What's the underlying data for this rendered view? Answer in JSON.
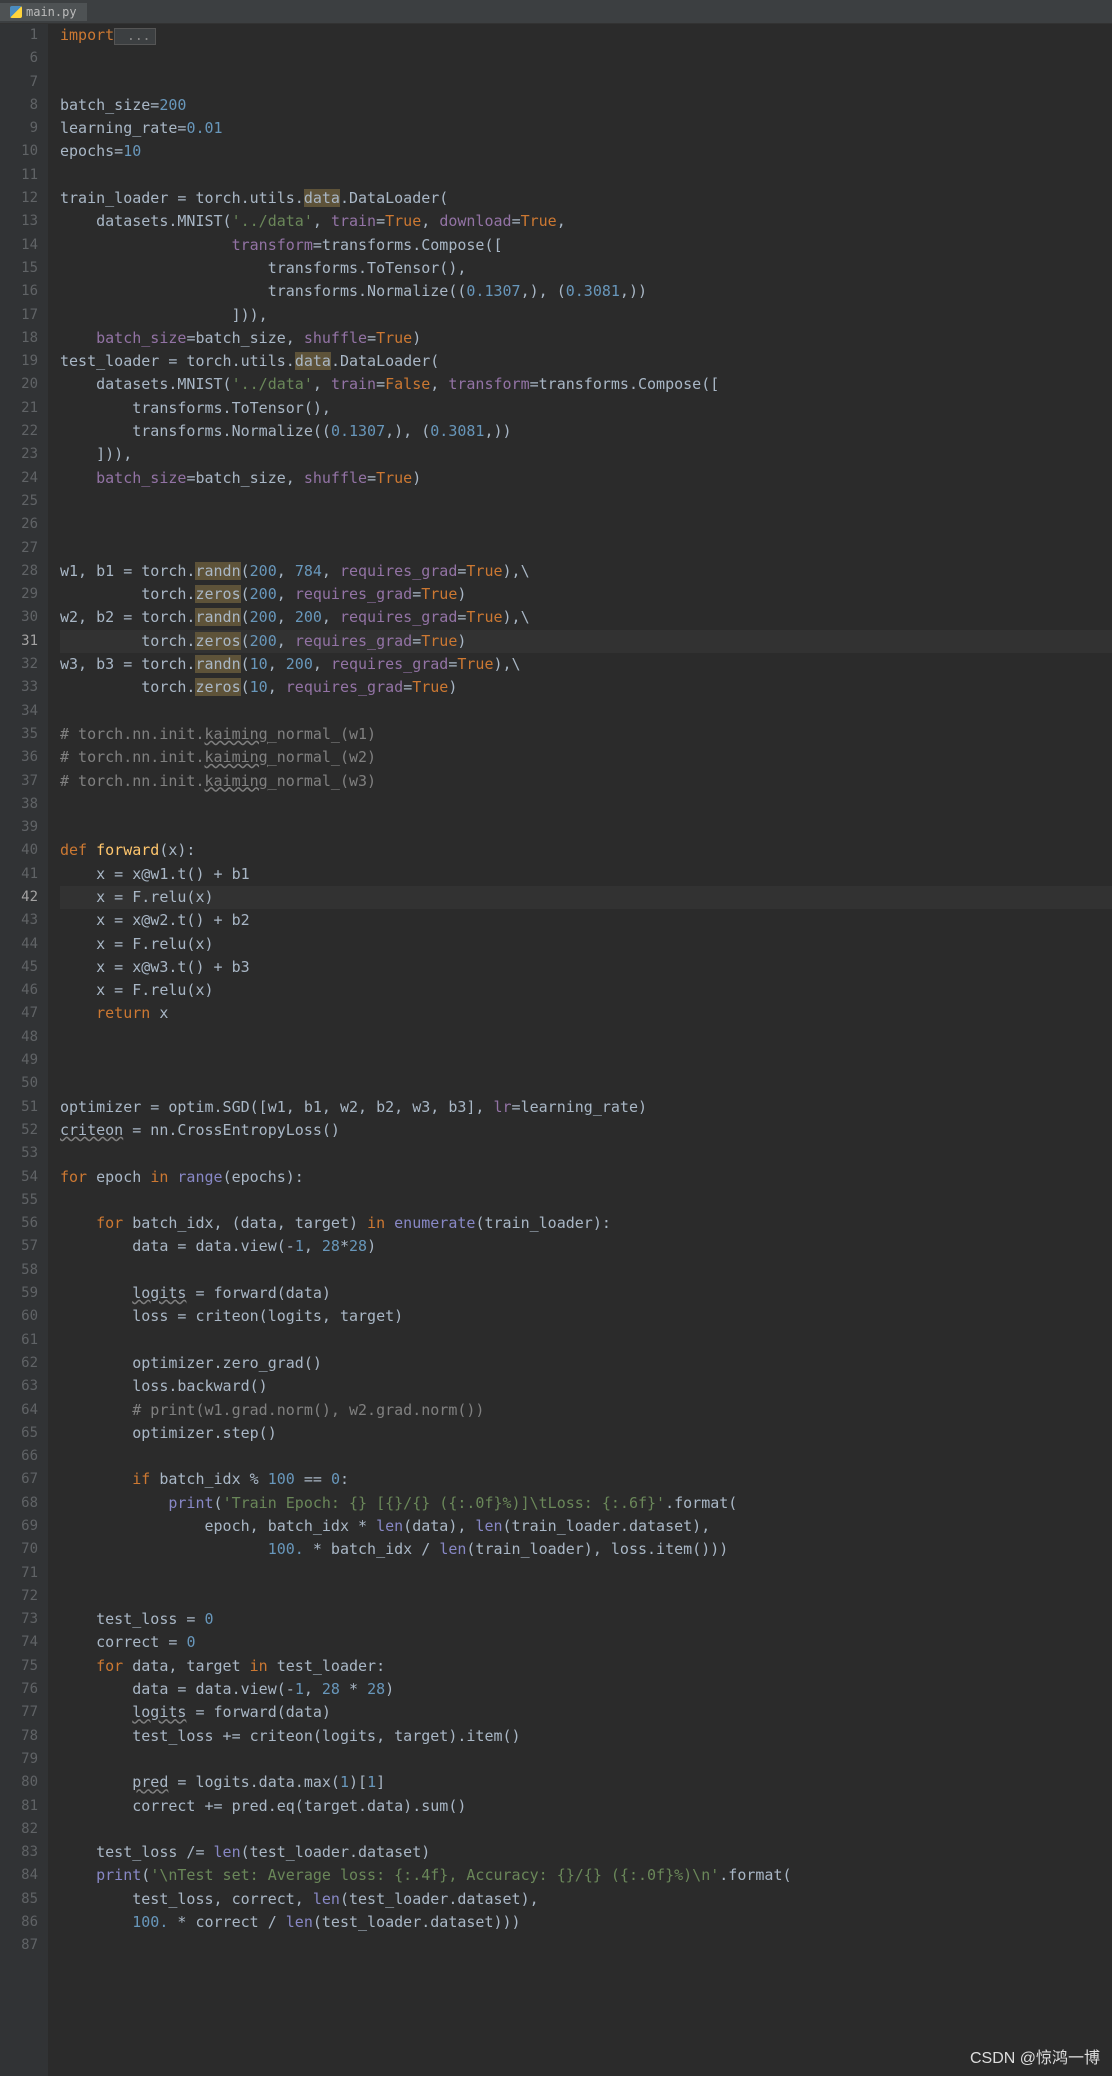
{
  "tab": {
    "filename": "main.py"
  },
  "watermark": "CSDN @惊鸿一博",
  "gutter_start": 1,
  "gutter_lines": 87,
  "code_lines": [
    {
      "n": 1,
      "tokens": [
        {
          "cls": "kw",
          "t": "import"
        },
        {
          "cls": "fold",
          "t": " ..."
        }
      ]
    },
    {
      "n": 6,
      "tokens": []
    },
    {
      "n": 7,
      "tokens": []
    },
    {
      "n": 8,
      "tokens": [
        {
          "t": "batch_size="
        },
        {
          "cls": "num",
          "t": "200"
        }
      ]
    },
    {
      "n": 9,
      "tokens": [
        {
          "t": "learning_rate="
        },
        {
          "cls": "num",
          "t": "0.01"
        }
      ]
    },
    {
      "n": 10,
      "tokens": [
        {
          "t": "epochs="
        },
        {
          "cls": "num",
          "t": "10"
        }
      ]
    },
    {
      "n": 11,
      "tokens": []
    },
    {
      "n": 12,
      "tokens": [
        {
          "t": "train_loader = torch.utils."
        },
        {
          "cls": "hl",
          "t": "data"
        },
        {
          "t": ".DataLoader("
        }
      ]
    },
    {
      "n": 13,
      "tokens": [
        {
          "t": "    datasets.MNIST("
        },
        {
          "cls": "str",
          "t": "'../data'"
        },
        {
          "cls": "op",
          "t": ", "
        },
        {
          "cls": "field",
          "t": "train"
        },
        {
          "t": "="
        },
        {
          "cls": "kw",
          "t": "True"
        },
        {
          "cls": "op",
          "t": ", "
        },
        {
          "cls": "field",
          "t": "download"
        },
        {
          "t": "="
        },
        {
          "cls": "kw",
          "t": "True"
        },
        {
          "cls": "op",
          "t": ","
        }
      ]
    },
    {
      "n": 14,
      "tokens": [
        {
          "t": "                   "
        },
        {
          "cls": "field",
          "t": "transform"
        },
        {
          "t": "=transforms.Compose(["
        }
      ]
    },
    {
      "n": 15,
      "tokens": [
        {
          "t": "                       transforms.ToTensor(),"
        }
      ]
    },
    {
      "n": 16,
      "tokens": [
        {
          "t": "                       transforms.Normalize(("
        },
        {
          "cls": "num",
          "t": "0.1307"
        },
        {
          "cls": "op",
          "t": ",), ("
        },
        {
          "cls": "num",
          "t": "0.3081"
        },
        {
          "cls": "op",
          "t": ",))"
        }
      ]
    },
    {
      "n": 17,
      "tokens": [
        {
          "t": "                   ])),"
        }
      ]
    },
    {
      "n": 18,
      "tokens": [
        {
          "t": "    "
        },
        {
          "cls": "field",
          "t": "batch_size"
        },
        {
          "t": "=batch_size, "
        },
        {
          "cls": "field",
          "t": "shuffle"
        },
        {
          "t": "="
        },
        {
          "cls": "kw",
          "t": "True"
        },
        {
          "t": ")"
        }
      ]
    },
    {
      "n": 19,
      "tokens": [
        {
          "t": "test_loader = torch.utils."
        },
        {
          "cls": "hl",
          "t": "data"
        },
        {
          "t": ".DataLoader("
        }
      ]
    },
    {
      "n": 20,
      "tokens": [
        {
          "t": "    datasets.MNIST("
        },
        {
          "cls": "str",
          "t": "'../data'"
        },
        {
          "cls": "op",
          "t": ", "
        },
        {
          "cls": "field",
          "t": "train"
        },
        {
          "t": "="
        },
        {
          "cls": "kw",
          "t": "False"
        },
        {
          "cls": "op",
          "t": ", "
        },
        {
          "cls": "field",
          "t": "transform"
        },
        {
          "t": "=transforms.Compose(["
        }
      ]
    },
    {
      "n": 21,
      "tokens": [
        {
          "t": "        transforms.ToTensor(),"
        }
      ]
    },
    {
      "n": 22,
      "tokens": [
        {
          "t": "        transforms.Normalize(("
        },
        {
          "cls": "num",
          "t": "0.1307"
        },
        {
          "cls": "op",
          "t": ",), ("
        },
        {
          "cls": "num",
          "t": "0.3081"
        },
        {
          "cls": "op",
          "t": ",))"
        }
      ]
    },
    {
      "n": 23,
      "tokens": [
        {
          "t": "    ])),"
        }
      ]
    },
    {
      "n": 24,
      "tokens": [
        {
          "t": "    "
        },
        {
          "cls": "field",
          "t": "batch_size"
        },
        {
          "t": "=batch_size, "
        },
        {
          "cls": "field",
          "t": "shuffle"
        },
        {
          "t": "="
        },
        {
          "cls": "kw",
          "t": "True"
        },
        {
          "t": ")"
        }
      ]
    },
    {
      "n": 25,
      "tokens": []
    },
    {
      "n": 26,
      "tokens": []
    },
    {
      "n": 27,
      "tokens": []
    },
    {
      "n": 28,
      "tokens": [
        {
          "t": "w1, b1 = torch."
        },
        {
          "cls": "hl",
          "t": "randn"
        },
        {
          "t": "("
        },
        {
          "cls": "num",
          "t": "200"
        },
        {
          "cls": "op",
          "t": ", "
        },
        {
          "cls": "num",
          "t": "784"
        },
        {
          "cls": "op",
          "t": ", "
        },
        {
          "cls": "field",
          "t": "requires_grad"
        },
        {
          "t": "="
        },
        {
          "cls": "kw",
          "t": "True"
        },
        {
          "t": "),\\"
        }
      ]
    },
    {
      "n": 29,
      "tokens": [
        {
          "t": "         torch."
        },
        {
          "cls": "hl",
          "t": "zeros"
        },
        {
          "t": "("
        },
        {
          "cls": "num",
          "t": "200"
        },
        {
          "cls": "op",
          "t": ", "
        },
        {
          "cls": "field",
          "t": "requires_grad"
        },
        {
          "t": "="
        },
        {
          "cls": "kw",
          "t": "True"
        },
        {
          "t": ")"
        }
      ]
    },
    {
      "n": 30,
      "tokens": [
        {
          "t": "w2, b2 = torch."
        },
        {
          "cls": "hl",
          "t": "randn"
        },
        {
          "t": "("
        },
        {
          "cls": "num",
          "t": "200"
        },
        {
          "cls": "op",
          "t": ", "
        },
        {
          "cls": "num",
          "t": "200"
        },
        {
          "cls": "op",
          "t": ", "
        },
        {
          "cls": "field",
          "t": "requires_grad"
        },
        {
          "t": "="
        },
        {
          "cls": "kw",
          "t": "True"
        },
        {
          "t": "),\\"
        }
      ]
    },
    {
      "n": 31,
      "cur": true,
      "tokens": [
        {
          "t": "         torch."
        },
        {
          "cls": "hl",
          "t": "zeros"
        },
        {
          "t": "("
        },
        {
          "cls": "num",
          "t": "200"
        },
        {
          "cls": "op",
          "t": ", "
        },
        {
          "cls": "field",
          "t": "requires_grad"
        },
        {
          "t": "="
        },
        {
          "cls": "kw",
          "t": "True"
        },
        {
          "t": ")"
        }
      ]
    },
    {
      "n": 32,
      "tokens": [
        {
          "t": "w3, b3 = torch."
        },
        {
          "cls": "hl",
          "t": "randn"
        },
        {
          "t": "("
        },
        {
          "cls": "num",
          "t": "10"
        },
        {
          "cls": "op",
          "t": ", "
        },
        {
          "cls": "num",
          "t": "200"
        },
        {
          "cls": "op",
          "t": ", "
        },
        {
          "cls": "field",
          "t": "requires_grad"
        },
        {
          "t": "="
        },
        {
          "cls": "kw",
          "t": "True"
        },
        {
          "t": "),\\"
        }
      ]
    },
    {
      "n": 33,
      "tokens": [
        {
          "t": "         torch."
        },
        {
          "cls": "hl",
          "t": "zeros"
        },
        {
          "t": "("
        },
        {
          "cls": "num",
          "t": "10"
        },
        {
          "cls": "op",
          "t": ", "
        },
        {
          "cls": "field",
          "t": "requires_grad"
        },
        {
          "t": "="
        },
        {
          "cls": "kw",
          "t": "True"
        },
        {
          "t": ")"
        }
      ]
    },
    {
      "n": 34,
      "tokens": []
    },
    {
      "n": 35,
      "tokens": [
        {
          "cls": "cmt",
          "t": "# torch.nn.init."
        },
        {
          "cls": "cmt ul",
          "t": "kaiming"
        },
        {
          "cls": "cmt",
          "t": "_normal_(w1)"
        }
      ]
    },
    {
      "n": 36,
      "tokens": [
        {
          "cls": "cmt",
          "t": "# torch.nn.init."
        },
        {
          "cls": "cmt ul",
          "t": "kaiming"
        },
        {
          "cls": "cmt",
          "t": "_normal_(w2)"
        }
      ]
    },
    {
      "n": 37,
      "tokens": [
        {
          "cls": "cmt",
          "t": "# torch.nn.init."
        },
        {
          "cls": "cmt ul",
          "t": "kaiming"
        },
        {
          "cls": "cmt",
          "t": "_normal_(w3)"
        }
      ]
    },
    {
      "n": 38,
      "tokens": []
    },
    {
      "n": 39,
      "tokens": []
    },
    {
      "n": 40,
      "tokens": [
        {
          "cls": "kw",
          "t": "def "
        },
        {
          "cls": "fn",
          "t": "forward"
        },
        {
          "t": "(x):"
        }
      ]
    },
    {
      "n": 41,
      "tokens": [
        {
          "t": "    x = x@w1.t() + b1"
        }
      ]
    },
    {
      "n": 42,
      "cur": true,
      "tokens": [
        {
          "t": "    x = F.relu(x)"
        }
      ]
    },
    {
      "n": 43,
      "tokens": [
        {
          "t": "    x = x@w2.t() + b2"
        }
      ]
    },
    {
      "n": 44,
      "tokens": [
        {
          "t": "    x = F.relu(x)"
        }
      ]
    },
    {
      "n": 45,
      "tokens": [
        {
          "t": "    x = x@w3.t() + b3"
        }
      ]
    },
    {
      "n": 46,
      "tokens": [
        {
          "t": "    x = F.relu(x)"
        }
      ]
    },
    {
      "n": 47,
      "tokens": [
        {
          "t": "    "
        },
        {
          "cls": "kw",
          "t": "return "
        },
        {
          "t": "x"
        }
      ]
    },
    {
      "n": 48,
      "tokens": []
    },
    {
      "n": 49,
      "tokens": []
    },
    {
      "n": 50,
      "tokens": []
    },
    {
      "n": 51,
      "tokens": [
        {
          "t": "optimizer = optim.SGD([w1, b1, w2, b2, w3, b3], "
        },
        {
          "cls": "field",
          "t": "lr"
        },
        {
          "t": "=learning_rate)"
        }
      ]
    },
    {
      "n": 52,
      "tokens": [
        {
          "cls": "ul",
          "t": "criteon"
        },
        {
          "t": " = nn.CrossEntropyLoss()"
        }
      ]
    },
    {
      "n": 53,
      "tokens": []
    },
    {
      "n": 54,
      "tokens": [
        {
          "cls": "kw",
          "t": "for "
        },
        {
          "t": "epoch "
        },
        {
          "cls": "kw",
          "t": "in "
        },
        {
          "cls": "bi",
          "t": "range"
        },
        {
          "t": "(epochs):"
        }
      ]
    },
    {
      "n": 55,
      "tokens": []
    },
    {
      "n": 56,
      "tokens": [
        {
          "t": "    "
        },
        {
          "cls": "kw",
          "t": "for "
        },
        {
          "t": "batch_idx, (data, target) "
        },
        {
          "cls": "kw",
          "t": "in "
        },
        {
          "cls": "bi",
          "t": "enumerate"
        },
        {
          "t": "(train_loader):"
        }
      ]
    },
    {
      "n": 57,
      "tokens": [
        {
          "t": "        data = data.view(-"
        },
        {
          "cls": "num",
          "t": "1"
        },
        {
          "cls": "op",
          "t": ", "
        },
        {
          "cls": "num",
          "t": "28"
        },
        {
          "t": "*"
        },
        {
          "cls": "num",
          "t": "28"
        },
        {
          "t": ")"
        }
      ]
    },
    {
      "n": 58,
      "tokens": []
    },
    {
      "n": 59,
      "tokens": [
        {
          "t": "        "
        },
        {
          "cls": "ul",
          "t": "logits"
        },
        {
          "t": " = forward(data)"
        }
      ]
    },
    {
      "n": 60,
      "tokens": [
        {
          "t": "        loss = criteon(logits, target)"
        }
      ]
    },
    {
      "n": 61,
      "tokens": []
    },
    {
      "n": 62,
      "tokens": [
        {
          "t": "        optimizer.zero_grad()"
        }
      ]
    },
    {
      "n": 63,
      "tokens": [
        {
          "t": "        loss.backward()"
        }
      ]
    },
    {
      "n": 64,
      "tokens": [
        {
          "t": "        "
        },
        {
          "cls": "cmt",
          "t": "# print(w1.grad.norm(), w2.grad.norm())"
        }
      ]
    },
    {
      "n": 65,
      "tokens": [
        {
          "t": "        optimizer.step()"
        }
      ]
    },
    {
      "n": 66,
      "tokens": []
    },
    {
      "n": 67,
      "tokens": [
        {
          "t": "        "
        },
        {
          "cls": "kw",
          "t": "if "
        },
        {
          "t": "batch_idx % "
        },
        {
          "cls": "num",
          "t": "100"
        },
        {
          "t": " == "
        },
        {
          "cls": "num",
          "t": "0"
        },
        {
          "t": ":"
        }
      ]
    },
    {
      "n": 68,
      "tokens": [
        {
          "t": "            "
        },
        {
          "cls": "bi",
          "t": "print"
        },
        {
          "t": "("
        },
        {
          "cls": "str",
          "t": "'Train Epoch: {} [{}/{} ({:.0f}%)]\\tLoss: {:.6f}'"
        },
        {
          "t": ".format("
        }
      ]
    },
    {
      "n": 69,
      "tokens": [
        {
          "t": "                epoch, batch_idx * "
        },
        {
          "cls": "bi",
          "t": "len"
        },
        {
          "t": "(data), "
        },
        {
          "cls": "bi",
          "t": "len"
        },
        {
          "t": "(train_loader.dataset),"
        }
      ]
    },
    {
      "n": 70,
      "tokens": [
        {
          "t": "                       "
        },
        {
          "cls": "num",
          "t": "100."
        },
        {
          "t": " * batch_idx / "
        },
        {
          "cls": "bi",
          "t": "len"
        },
        {
          "t": "(train_loader), loss.item()))"
        }
      ]
    },
    {
      "n": 71,
      "tokens": []
    },
    {
      "n": 72,
      "tokens": []
    },
    {
      "n": 73,
      "tokens": [
        {
          "t": "    test_loss = "
        },
        {
          "cls": "num",
          "t": "0"
        }
      ]
    },
    {
      "n": 74,
      "tokens": [
        {
          "t": "    correct = "
        },
        {
          "cls": "num",
          "t": "0"
        }
      ]
    },
    {
      "n": 75,
      "tokens": [
        {
          "t": "    "
        },
        {
          "cls": "kw",
          "t": "for "
        },
        {
          "t": "data, target "
        },
        {
          "cls": "kw",
          "t": "in "
        },
        {
          "t": "test_loader:"
        }
      ]
    },
    {
      "n": 76,
      "tokens": [
        {
          "t": "        data = data.view(-"
        },
        {
          "cls": "num",
          "t": "1"
        },
        {
          "cls": "op",
          "t": ", "
        },
        {
          "cls": "num",
          "t": "28"
        },
        {
          "t": " * "
        },
        {
          "cls": "num",
          "t": "28"
        },
        {
          "t": ")"
        }
      ]
    },
    {
      "n": 77,
      "tokens": [
        {
          "t": "        "
        },
        {
          "cls": "ul",
          "t": "logits"
        },
        {
          "t": " = forward(data)"
        }
      ]
    },
    {
      "n": 78,
      "tokens": [
        {
          "t": "        test_loss += criteon(logits, target).item()"
        }
      ]
    },
    {
      "n": 79,
      "tokens": []
    },
    {
      "n": 80,
      "tokens": [
        {
          "t": "        "
        },
        {
          "cls": "ul",
          "t": "pred"
        },
        {
          "t": " = logits.data.max("
        },
        {
          "cls": "num",
          "t": "1"
        },
        {
          "t": ")["
        },
        {
          "cls": "num",
          "t": "1"
        },
        {
          "t": "]"
        }
      ]
    },
    {
      "n": 81,
      "tokens": [
        {
          "t": "        correct += pred.eq(target.data).sum()"
        }
      ]
    },
    {
      "n": 82,
      "tokens": []
    },
    {
      "n": 83,
      "tokens": [
        {
          "t": "    test_loss /= "
        },
        {
          "cls": "bi",
          "t": "len"
        },
        {
          "t": "(test_loader.dataset)"
        }
      ]
    },
    {
      "n": 84,
      "tokens": [
        {
          "t": "    "
        },
        {
          "cls": "bi",
          "t": "print"
        },
        {
          "t": "("
        },
        {
          "cls": "str",
          "t": "'\\nTest set: Average loss: {:.4f}, Accuracy: {}/{} ({:.0f}%)\\n'"
        },
        {
          "t": ".format("
        }
      ]
    },
    {
      "n": 85,
      "tokens": [
        {
          "t": "        test_loss, correct, "
        },
        {
          "cls": "bi",
          "t": "len"
        },
        {
          "t": "(test_loader.dataset),"
        }
      ]
    },
    {
      "n": 86,
      "tokens": [
        {
          "t": "        "
        },
        {
          "cls": "num",
          "t": "100."
        },
        {
          "t": " * correct / "
        },
        {
          "cls": "bi",
          "t": "len"
        },
        {
          "t": "(test_loader.dataset)))"
        }
      ]
    },
    {
      "n": 87,
      "tokens": []
    }
  ]
}
